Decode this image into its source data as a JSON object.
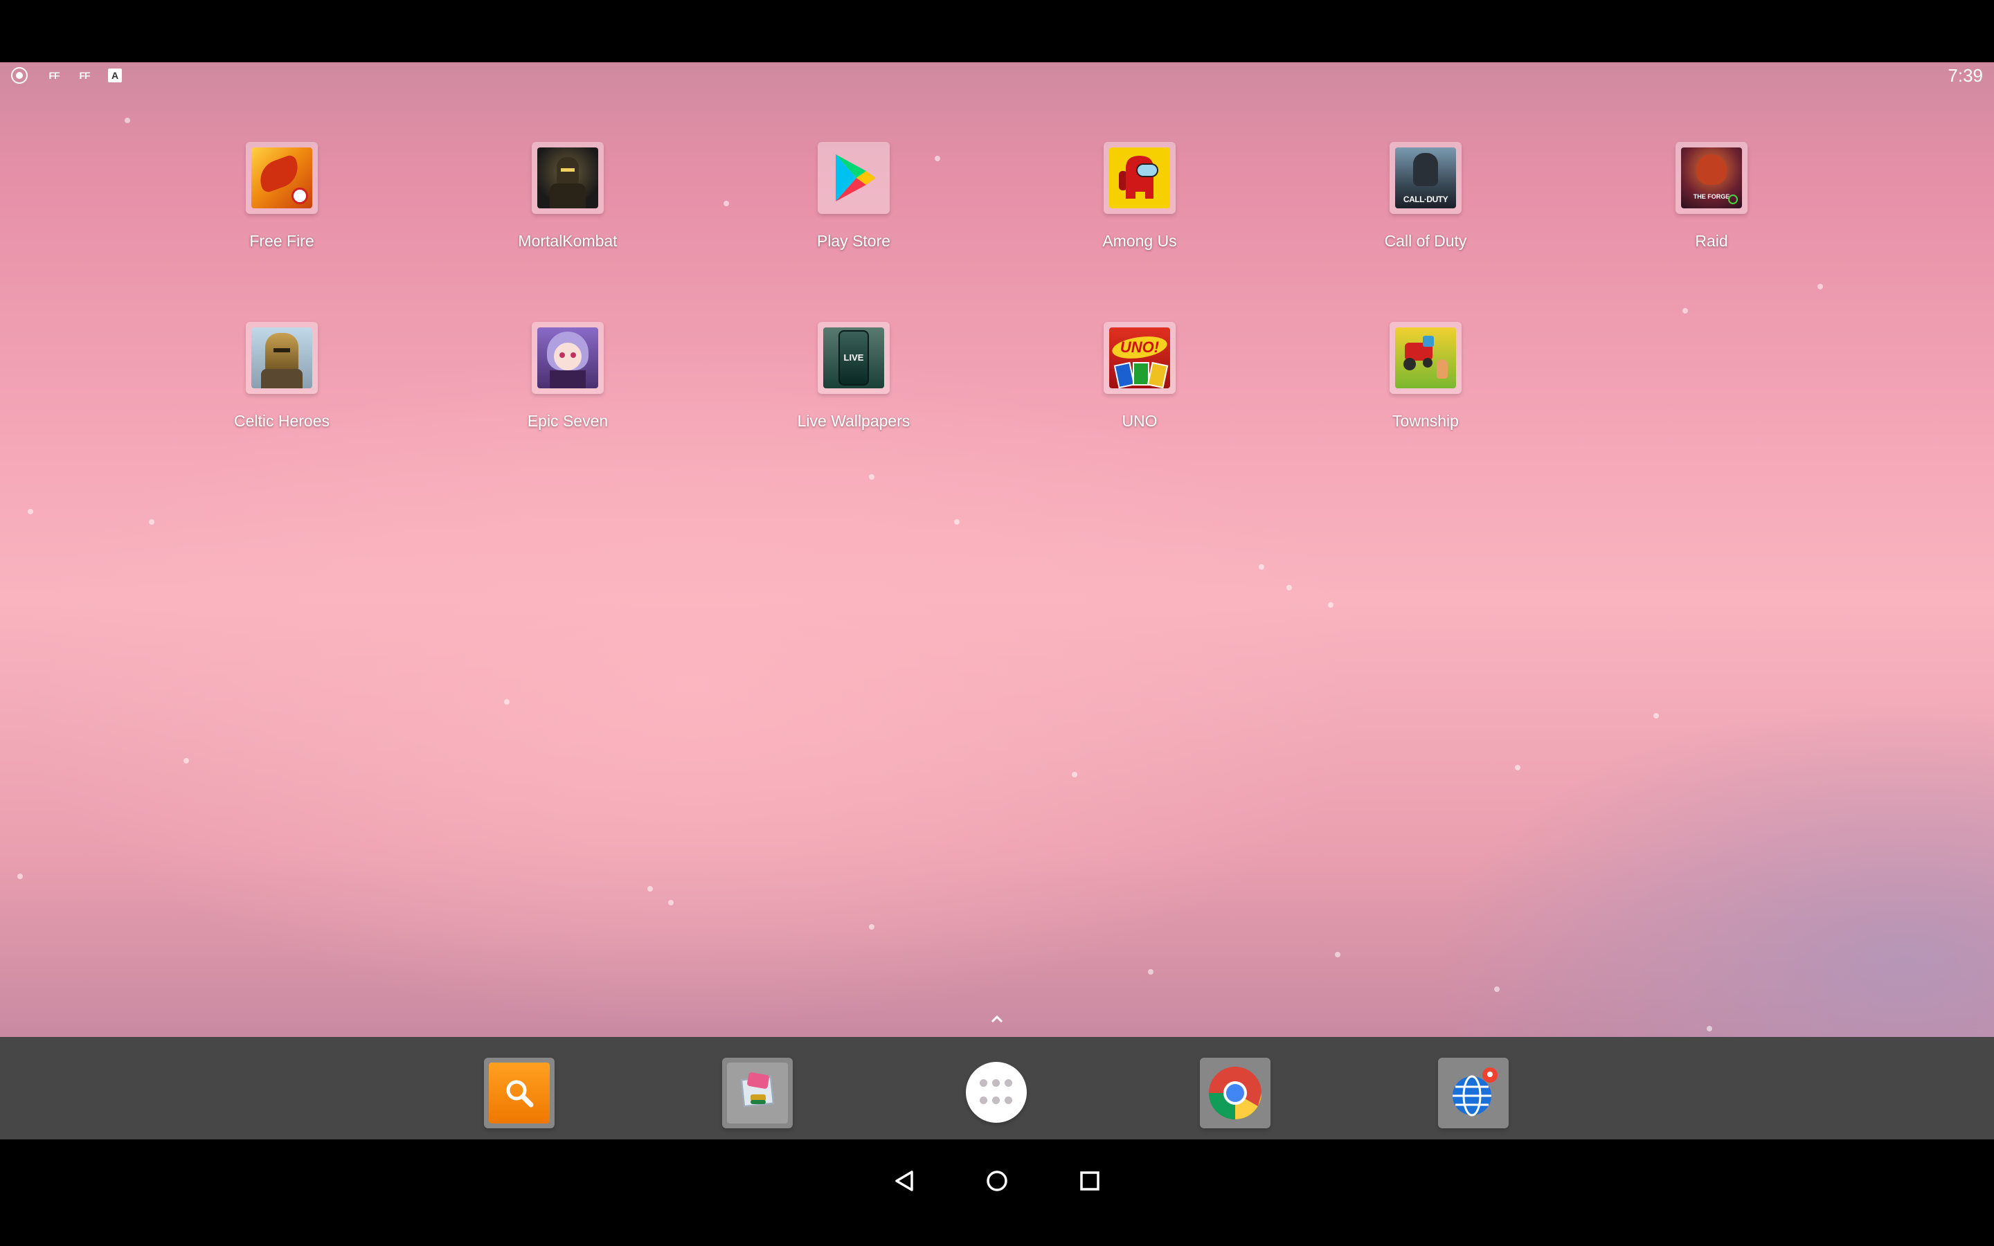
{
  "status_bar": {
    "notification_icons": [
      "gamepad-icon",
      "ff-icon",
      "ff-icon",
      "text-a-icon"
    ],
    "ff_label": "FF",
    "a_label": "A",
    "time": "7:39"
  },
  "home": {
    "apps": [
      {
        "label": "Free Fire",
        "icon": "free-fire-icon",
        "color": "#f0a020"
      },
      {
        "label": "MortalKombat",
        "icon": "mortal-kombat-icon",
        "color": "#2a2a2a"
      },
      {
        "label": "Play Store",
        "icon": "play-store-icon",
        "color": "#ffffff"
      },
      {
        "label": "Among Us",
        "icon": "among-us-icon",
        "color": "#f7d000"
      },
      {
        "label": "Call of Duty",
        "icon": "call-of-duty-icon",
        "color": "#4a5a6a"
      },
      {
        "label": "Raid",
        "icon": "raid-icon",
        "color": "#5a2a3a"
      },
      {
        "label": "Celtic Heroes",
        "icon": "celtic-heroes-icon",
        "color": "#6a6050"
      },
      {
        "label": "Epic Seven",
        "icon": "epic-seven-icon",
        "color": "#7a5aa8"
      },
      {
        "label": "Live Wallpapers",
        "icon": "live-wallpapers-icon",
        "color": "#2a5a50"
      },
      {
        "label": "UNO",
        "icon": "uno-icon",
        "color": "#d02020"
      },
      {
        "label": "Township",
        "icon": "township-icon",
        "color": "#e8c020"
      }
    ],
    "art_text": {
      "call_of_duty": "CALL·DUTY",
      "live": "LIVE",
      "uno": "UNO!",
      "raid": "THE FORGE"
    }
  },
  "dock": {
    "items": [
      "search-app-icon",
      "gallery-app-icon",
      "all-apps-icon",
      "chrome-icon",
      "browser-globe-icon"
    ]
  },
  "nav": {
    "buttons": [
      "back-icon",
      "home-icon",
      "recents-icon"
    ]
  },
  "colors": {
    "wallpaper_top": "#cf8aa0",
    "wallpaper_mid": "#f9b4c0",
    "accent_orange": "#f08a00"
  }
}
